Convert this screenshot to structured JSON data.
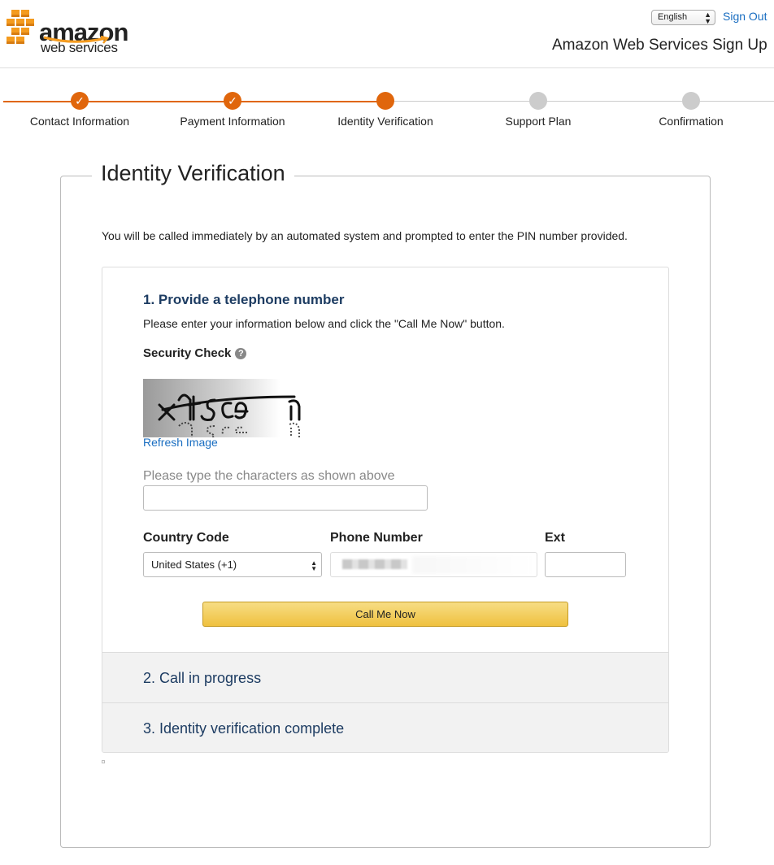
{
  "header": {
    "brand_name": "amazon",
    "brand_sub": "web services",
    "language": "English",
    "sign_out": "Sign Out",
    "page_heading": "Amazon Web Services Sign Up"
  },
  "stepper": {
    "steps": [
      {
        "label": "Contact Information",
        "status": "complete"
      },
      {
        "label": "Payment Information",
        "status": "complete"
      },
      {
        "label": "Identity Verification",
        "status": "current"
      },
      {
        "label": "Support Plan",
        "status": "pending"
      },
      {
        "label": "Confirmation",
        "status": "pending"
      }
    ],
    "check_glyph": "✓"
  },
  "main": {
    "title": "Identity Verification",
    "intro": "You will be called immediately by an automated system and prompted to enter the PIN number provided.",
    "section1": {
      "title": "1. Provide a telephone number",
      "desc": "Please enter your information below and click the \"Call Me Now\" button.",
      "security_check": "Security Check",
      "help_glyph": "?",
      "refresh": "Refresh Image",
      "captcha_label": "Please type the characters as shown above",
      "captcha_value": "",
      "country_code_label": "Country Code",
      "country_code_value": "United States (+1)",
      "phone_label": "Phone Number",
      "ext_label": "Ext",
      "ext_value": "",
      "call_button": "Call Me Now"
    },
    "section2": "2. Call in progress",
    "section3": "3. Identity verification complete"
  },
  "colors": {
    "accent_orange": "#e0660c",
    "link_blue": "#1a6ec1",
    "heading_navy": "#1d3c62",
    "button_gold": "#efc13f"
  }
}
